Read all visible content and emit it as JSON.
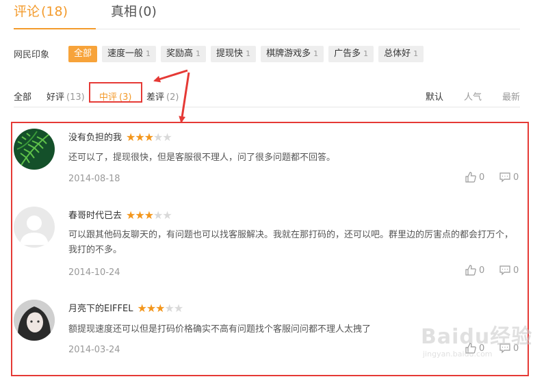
{
  "tabs": [
    {
      "label": "评论",
      "count": "(18)"
    },
    {
      "label": "真相",
      "count": "(0)"
    }
  ],
  "impression": {
    "label": "网民印象",
    "tags": [
      {
        "label": "全部",
        "count": ""
      },
      {
        "label": "速度一般",
        "count": "1"
      },
      {
        "label": "奖励高",
        "count": "1"
      },
      {
        "label": "提现快",
        "count": "1"
      },
      {
        "label": "棋牌游戏多",
        "count": "1"
      },
      {
        "label": "广告多",
        "count": "1"
      },
      {
        "label": "总体好",
        "count": "1"
      }
    ]
  },
  "filters": {
    "all": "全部",
    "good": {
      "label": "好评",
      "count": "(13)"
    },
    "medium": {
      "label": "中评",
      "count": "(3)"
    },
    "bad": {
      "label": "差评",
      "count": "(2)"
    },
    "sort_default": "默认",
    "sort_popular": "人气",
    "sort_latest": "最新"
  },
  "reviews": [
    {
      "user": "没有负担的我",
      "rating": 3,
      "text": "还可以了，提现很快，但是客服很不理人，问了很多问题都不回答。",
      "date": "2014-08-18",
      "likes": "0",
      "comments": "0"
    },
    {
      "user": "春哥时代已去",
      "rating": 3,
      "text": "可以跟其他码友聊天的，有问题也可以找客服解决。我就在那打码的，还可以吧。群里边的厉害点的都会打万个，我打的不多。",
      "date": "2014-10-24",
      "likes": "0",
      "comments": "0"
    },
    {
      "user": "月亮下的EIFFEL",
      "rating": 3,
      "text": "额提现速度还可以但是打码价格确实不高有问题找个客服问问都不理人太拽了",
      "date": "2014-03-24",
      "likes": "0",
      "comments": "0"
    }
  ],
  "watermark": {
    "main": "Baidu经验",
    "sub": "jingyan.baidu.com"
  },
  "colors": {
    "accent": "#f39a2b",
    "star": "#f3961c",
    "highlight": "#e53935"
  }
}
